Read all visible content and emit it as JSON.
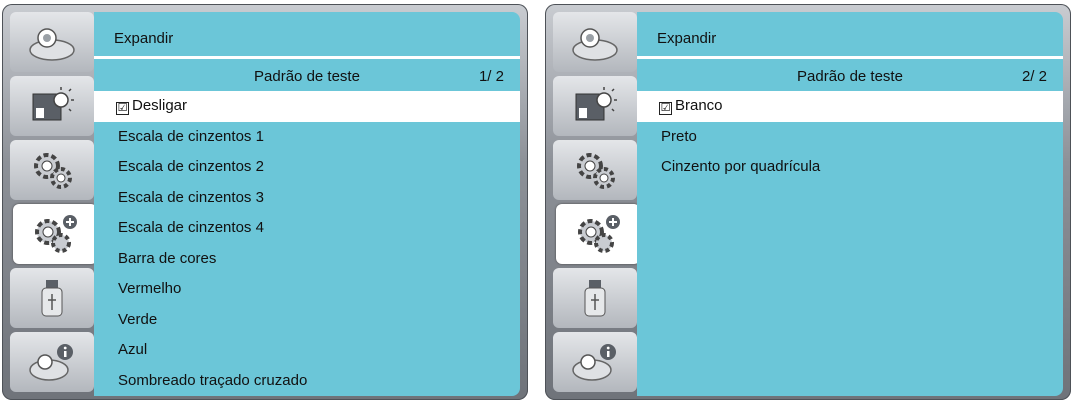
{
  "panels": [
    {
      "header_title": "Expandir",
      "subtitle": "Padrão de teste",
      "page_indicator": "1/ 2",
      "selected_mark": "☑",
      "items": [
        {
          "label": "Desligar",
          "selected": true
        },
        {
          "label": "Escala de cinzentos 1",
          "selected": false
        },
        {
          "label": "Escala de cinzentos 2",
          "selected": false
        },
        {
          "label": "Escala de cinzentos 3",
          "selected": false
        },
        {
          "label": "Escala de cinzentos 4",
          "selected": false
        },
        {
          "label": "Barra de cores",
          "selected": false
        },
        {
          "label": "Vermelho",
          "selected": false
        },
        {
          "label": "Verde",
          "selected": false
        },
        {
          "label": "Azul",
          "selected": false
        },
        {
          "label": "Sombreado traçado cruzado",
          "selected": false
        }
      ]
    },
    {
      "header_title": "Expandir",
      "subtitle": "Padrão de teste",
      "page_indicator": "2/ 2",
      "selected_mark": "☑",
      "items": [
        {
          "label": "Branco",
          "selected": true
        },
        {
          "label": "Preto",
          "selected": false
        },
        {
          "label": "Cinzento por quadrícula",
          "selected": false
        }
      ]
    }
  ],
  "sidebar_icons": [
    "projector-icon",
    "brightness-icon",
    "gear-icon",
    "gear-plus-icon",
    "usb-icon",
    "projector-info-icon"
  ],
  "active_sidebar_index": 3,
  "colors": {
    "content_bg": "#6bc6d8",
    "selected_row": "#ffffff",
    "frame": "#8d9198"
  }
}
